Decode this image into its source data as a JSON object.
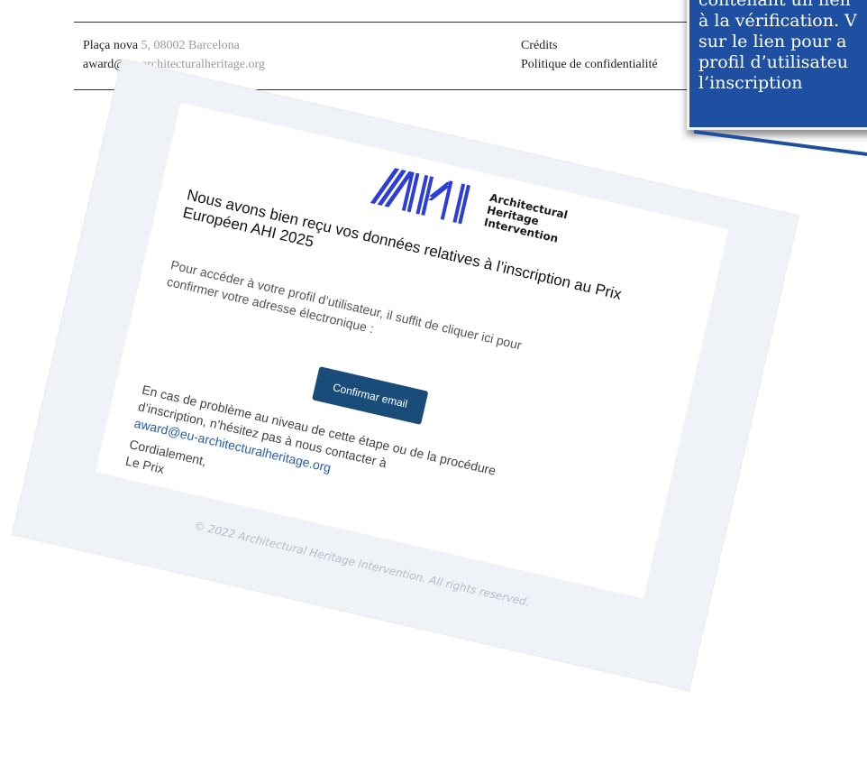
{
  "footer": {
    "address_prefix": "Plaça nova",
    "address_rest": " 5, 08002 Barcelona",
    "email_prefix": "award@eu",
    "email_rest": "-architecturalheritage.org",
    "credits": "Crédits",
    "privacy": "Politique de confidentialité"
  },
  "email": {
    "logo_letters": "AHI",
    "logo_line1": "Architectural",
    "logo_line2": "Heritage",
    "logo_line3": "Intervention",
    "title": "Nous avons bien reçu vos données relatives à l’inscription au Prix Européen AHI 2025",
    "body": "Pour accéder à votre profil d’utilisateur, il suffit de cliquer ici pour confirmer votre adresse électronique :",
    "confirm_button": "Confirmar email",
    "help_text": "En cas de problème au niveau de cette étape ou de la procédure d’inscription, n’hésitez pas à nous contacter à",
    "help_link": "award@eu-architecturalheritage.org",
    "sign_line1": "Cordialement,",
    "sign_line2": "Le Prix",
    "copyright": "© 2022 Architectural Heritage Intervention. All rights reserved."
  },
  "callout": {
    "line1": "contenant un lien",
    "line2": "à la vérification. V",
    "line3": "sur le lien pour a",
    "line4": "profil d’utilisateu",
    "line5": "l’inscription"
  },
  "colors": {
    "callout_bg": "#1f4fa0",
    "button_bg": "#1a4c7a",
    "link": "#2a5dab",
    "email_bg": "#eff2f6"
  }
}
